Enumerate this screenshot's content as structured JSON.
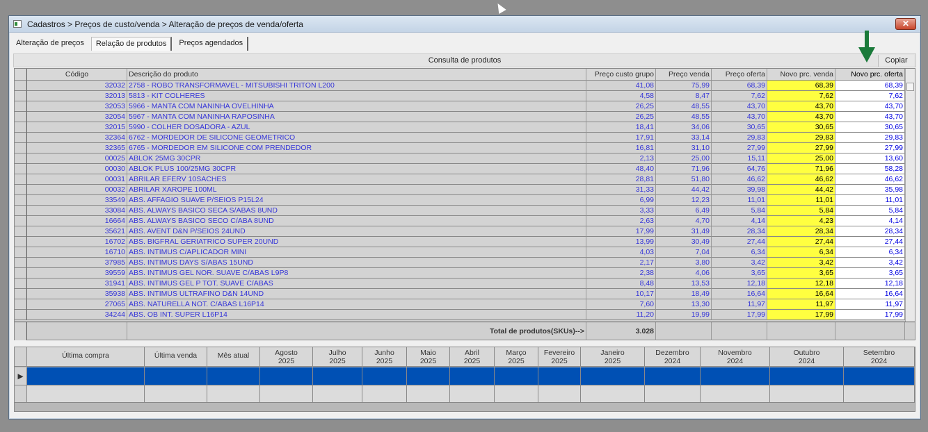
{
  "window": {
    "title": "Cadastros > Preços de custo/venda > Alteração de preços de venda/oferta",
    "close": "✕"
  },
  "tabs": [
    "Alteração de preços",
    "Relação de produtos",
    "Preços agendados"
  ],
  "consulta": {
    "label": "Consulta de produtos",
    "copy_button": "Copiar"
  },
  "products": {
    "columns": [
      "Código",
      "Descrição do produto",
      "Preço custo grupo",
      "Preço venda",
      "Preço oferta",
      "Novo prc. venda",
      "Novo prc. oferta"
    ],
    "rows": [
      [
        "32032",
        "2758 - ROBO TRANSFORMAVEL - MITSUBISHI TRITON L200",
        "41,08",
        "75,99",
        "68,39",
        "68,39",
        "68,39"
      ],
      [
        "32013",
        "5813 - KIT COLHERES",
        "4,58",
        "8,47",
        "7,62",
        "7,62",
        "7,62"
      ],
      [
        "32053",
        "5966 - MANTA COM NANINHA OVELHINHA",
        "26,25",
        "48,55",
        "43,70",
        "43,70",
        "43,70"
      ],
      [
        "32054",
        "5967 - MANTA COM NANINHA RAPOSINHA",
        "26,25",
        "48,55",
        "43,70",
        "43,70",
        "43,70"
      ],
      [
        "32015",
        "5990 - COLHER DOSADORA - AZUL",
        "18,41",
        "34,06",
        "30,65",
        "30,65",
        "30,65"
      ],
      [
        "32364",
        "6762 - MORDEDOR DE SILICONE GEOMETRICO",
        "17,91",
        "33,14",
        "29,83",
        "29,83",
        "29,83"
      ],
      [
        "32365",
        "6765 - MORDEDOR EM SILICONE COM PRENDEDOR",
        "16,81",
        "31,10",
        "27,99",
        "27,99",
        "27,99"
      ],
      [
        "00025",
        "ABLOK  25MG 30CPR",
        "2,13",
        "25,00",
        "15,11",
        "25,00",
        "13,60"
      ],
      [
        "00030",
        "ABLOK PLUS 100/25MG 30CPR",
        "48,40",
        "71,96",
        "64,76",
        "71,96",
        "58,28"
      ],
      [
        "00031",
        "ABRILAR EFERV 10SACHES",
        "28,81",
        "51,80",
        "46,62",
        "46,62",
        "46,62"
      ],
      [
        "00032",
        "ABRILAR XAROPE 100ML",
        "31,33",
        "44,42",
        "39,98",
        "44,42",
        "35,98"
      ],
      [
        "33549",
        "ABS. AFFAGIO SUAVE P/SEIOS P15L24",
        "6,99",
        "12,23",
        "11,01",
        "11,01",
        "11,01"
      ],
      [
        "33084",
        "ABS. ALWAYS BASICO SECA S/ABAS 8UND",
        "3,33",
        "6,49",
        "5,84",
        "5,84",
        "5,84"
      ],
      [
        "16664",
        "ABS. ALWAYS BASICO SECO C/ABA 8UND",
        "2,63",
        "4,70",
        "4,14",
        "4,23",
        "4,14"
      ],
      [
        "35621",
        "ABS. AVENT D&N P/SEIOS 24UND",
        "17,99",
        "31,49",
        "28,34",
        "28,34",
        "28,34"
      ],
      [
        "16702",
        "ABS. BIGFRAL GERIATRICO SUPER 20UND",
        "13,99",
        "30,49",
        "27,44",
        "27,44",
        "27,44"
      ],
      [
        "16710",
        "ABS. INTIMUS C/APLICADOR MINI",
        "4,03",
        "7,04",
        "6,34",
        "6,34",
        "6,34"
      ],
      [
        "37985",
        "ABS. INTIMUS DAYS S/ABAS 15UND",
        "2,17",
        "3,80",
        "3,42",
        "3,42",
        "3,42"
      ],
      [
        "39559",
        "ABS. INTIMUS GEL NOR. SUAVE C/ABAS L9P8",
        "2,38",
        "4,06",
        "3,65",
        "3,65",
        "3,65"
      ],
      [
        "31941",
        "ABS. INTIMUS GEL P TOT. SUAVE C/ABAS",
        "8,48",
        "13,53",
        "12,18",
        "12,18",
        "12,18"
      ],
      [
        "35938",
        "ABS. INTIMUS ULTRAFINO D&N 14UND",
        "10,17",
        "18,49",
        "16,64",
        "16,64",
        "16,64"
      ],
      [
        "27065",
        "ABS. NATURELLA NOT. C/ABAS L16P14",
        "7,60",
        "13,30",
        "11,97",
        "11,97",
        "11,97"
      ],
      [
        "34244",
        "ABS. OB INT. SUPER L16P14",
        "11,20",
        "19,99",
        "17,99",
        "17,99",
        "17,99"
      ]
    ],
    "total_label": "Total de produtos(SKUs)-->",
    "total_value": "3.028"
  },
  "history": {
    "columns": [
      "Última compra",
      "Última venda",
      "Mês atual",
      "Agosto\n2025",
      "Julho\n2025",
      "Junho\n2025",
      "Maio\n2025",
      "Abril\n2025",
      "Março\n2025",
      "Fevereiro\n2025",
      "Janeiro\n2025",
      "Dezembro\n2024",
      "Novembro\n2024",
      "Outubro\n2024",
      "Setembro\n2024"
    ],
    "row_indicator": "▶"
  },
  "colors": {
    "highlight": "#ffff40",
    "selection": "#0050b4",
    "annotation_arrow": "#1a7a3a"
  }
}
